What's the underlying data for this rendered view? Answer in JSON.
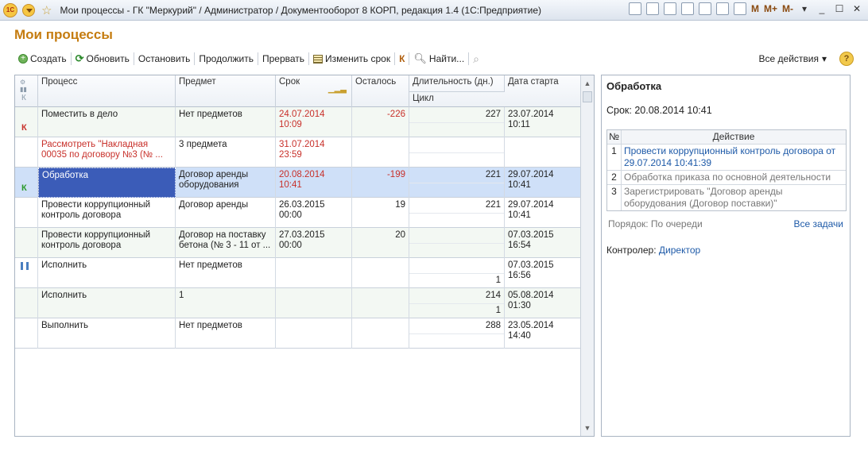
{
  "window": {
    "title": "Мои процессы - ГК \"Меркурий\" / Администратор / Документооборот 8 КОРП, редакция 1.4  (1С:Предприятие)",
    "logo": "1С",
    "m_buttons": [
      "M",
      "M+",
      "M-"
    ]
  },
  "form": {
    "title": "Мои процессы"
  },
  "toolbar": {
    "create": "Создать",
    "refresh": "Обновить",
    "stop": "Остановить",
    "resume": "Продолжить",
    "abort": "Прервать",
    "change_due": "Изменить срок",
    "k": "К",
    "find": "Найти...",
    "all_actions": "Все действия",
    "help": "?"
  },
  "table": {
    "columns": {
      "k": "К",
      "process": "Процесс",
      "subject": "Предмет",
      "due": "Срок",
      "left": "Осталось",
      "duration": "Длительность (дн.)",
      "cycle": "Цикл",
      "start": "Дата старта"
    },
    "rows": [
      {
        "mark": "К",
        "mark_color": "#c8302a",
        "process": "Поместить в дело",
        "subject": "Нет предметов",
        "due": "24.07.2014 10:09",
        "due_red": true,
        "left": "-226",
        "left_red": true,
        "duration": "227",
        "cycle": "",
        "start": "23.07.2014 10:11"
      },
      {
        "mark": "",
        "process": "Рассмотреть \"Накладная 00035 по договору №3 (№ ...",
        "process_red": true,
        "subject": "3 предмета",
        "due": "31.07.2014 23:59",
        "due_red": true,
        "left": "",
        "duration": "",
        "cycle": "",
        "start": ""
      },
      {
        "mark": "К",
        "mark_color": "#2a9a2a",
        "process": "Обработка",
        "subject": "Договор аренды оборудования",
        "due": "20.08.2014 10:41",
        "due_red": true,
        "left": "-199",
        "left_red": true,
        "duration": "221",
        "cycle": "",
        "start": "29.07.2014 10:41",
        "selected": true
      },
      {
        "mark": "",
        "process": "Провести коррупционный контроль договора",
        "subject": "Договор аренды",
        "due": "26.03.2015 00:00",
        "left": "19",
        "duration": "221",
        "cycle": "",
        "start": "29.07.2014 10:41"
      },
      {
        "mark": "",
        "process": "Провести коррупционный контроль договора",
        "subject": "Договор на поставку бетона (№ 3 - 11 от ...",
        "due": "27.03.2015 00:00",
        "left": "20",
        "duration": "",
        "cycle": "",
        "start": "07.03.2015 16:54"
      },
      {
        "mark": "pause",
        "process": "Исполнить",
        "subject": "Нет предметов",
        "due": "",
        "left": "",
        "duration": "",
        "cycle": "1",
        "start": "07.03.2015 16:56"
      },
      {
        "mark": "",
        "process": "Исполнить",
        "subject": "1",
        "due": "",
        "left": "",
        "duration": "214",
        "cycle": "1",
        "start": "05.08.2014 01:30"
      },
      {
        "mark": "",
        "process": "Выполнить",
        "subject": "Нет предметов",
        "due": "",
        "left": "",
        "duration": "288",
        "cycle": "",
        "start": "23.05.2014 14:40"
      }
    ]
  },
  "panel": {
    "title": "Обработка",
    "due": "Срок: 20.08.2014 10:41",
    "table_header_num": "№",
    "table_header_action": "Действие",
    "actions": [
      {
        "n": "1",
        "text": "Провести коррупционный контроль договора от 29.07.2014 10:41:39",
        "style": "link"
      },
      {
        "n": "2",
        "text": "Обработка приказа по основной деятельности",
        "style": "grey"
      },
      {
        "n": "3",
        "text": "Зарегистрировать \"Договор аренды оборудования (Договор поставки)\"",
        "style": "grey"
      }
    ],
    "order": "Порядок: По очереди",
    "all_tasks": "Все задачи",
    "controller_label": "Контролер:",
    "controller": "Директор"
  }
}
